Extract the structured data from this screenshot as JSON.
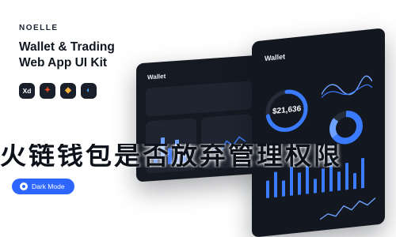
{
  "brand": {
    "name": "NOELLE"
  },
  "hero": {
    "title_line1": "Wallet & Trading",
    "title_line2": "Web App UI Kit"
  },
  "tools": {
    "items": [
      {
        "label": "Xd",
        "icon": "adobe-xd-icon"
      },
      {
        "label": "✦",
        "icon": "figma-icon"
      },
      {
        "label": "◆",
        "icon": "sketch-icon"
      },
      {
        "label": "◐",
        "icon": "framer-icon"
      }
    ]
  },
  "toggle": {
    "label": "Dark Mode"
  },
  "mockup": {
    "app_title": "Wallet",
    "balance": "$21,636",
    "ring_progress": 0.72,
    "accent": "#3b7bff",
    "accent2": "#6fa2ff"
  },
  "banner": {
    "text": "火链钱包是否放弃管理权限"
  },
  "colors": {
    "button": "#2d66ff",
    "device": "#121720"
  }
}
